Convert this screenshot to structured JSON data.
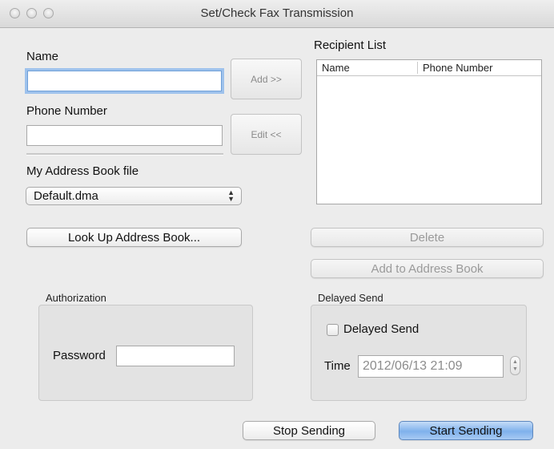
{
  "window": {
    "title": "Set/Check Fax Transmission"
  },
  "entry": {
    "name_label": "Name",
    "name_value": "",
    "phone_label": "Phone Number",
    "phone_value": "",
    "add_button": "Add >>",
    "edit_button": "Edit <<"
  },
  "address_book": {
    "label": "My Address Book file",
    "selected": "Default.dma",
    "lookup_button": "Look Up Address Book..."
  },
  "recipients": {
    "label": "Recipient List",
    "columns": [
      "Name",
      "Phone Number"
    ],
    "rows": [],
    "delete_button": "Delete",
    "add_to_book_button": "Add to Address Book"
  },
  "authorization": {
    "group_label": "Authorization",
    "password_label": "Password",
    "password_value": ""
  },
  "delayed_send": {
    "group_label": "Delayed Send",
    "checkbox_label": "Delayed Send",
    "checked": false,
    "time_label": "Time",
    "time_value": "2012/06/13 21:09"
  },
  "footer": {
    "stop_button": "Stop Sending",
    "start_button": "Start Sending"
  },
  "colors": {
    "focus_ring": "#9ec2ec",
    "default_button": "#7fb1ec"
  }
}
